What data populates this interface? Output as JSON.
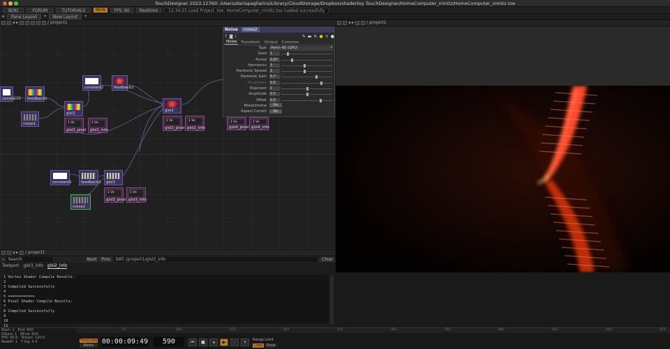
{
  "window": {
    "title": "TouchDesigner 2023.11760: /Users/dariopagliarico/Library/CloudStorage/Dropbox/shadertoy TouchDesigner/HomeComputer_nimitz/HomeComputer_nimitz.toe"
  },
  "menubar": {
    "items": [
      "BOKI",
      "FORUM",
      "TUTORIALS"
    ],
    "badge": "NEW",
    "fps": "FPS: 60",
    "realtime": "Realtime",
    "status": "12:34:25 Load Project .toe: HomeComputer_nimitz.toe loaded successfully"
  },
  "layout": {
    "tabs": [
      "Pane Layout",
      "New Layout"
    ],
    "plus": "+"
  },
  "left_pane": {
    "path": "/ project1"
  },
  "right_pane": {
    "path": "/ project1"
  },
  "nodes": {
    "constant1": "constant1",
    "feedback1": "feedback1",
    "noise1": "noise1",
    "glsl1": "glsl1",
    "glsl1_pixel": "glsl1_pixel",
    "glsl1_info": "glsl1_info",
    "constant2": "constant2",
    "feedback2": "feedback2",
    "glsl2": "glsl2",
    "glsl2_pixel": "glsl2_pixel",
    "glsl2_info": "glsl2_info",
    "glsl4_pixel": "glsl4_pixel",
    "glsl4_info": "glsl4_info",
    "constant3": "constant3",
    "feedback3": "feedback3",
    "glsl3": "glsl3",
    "glsl3_pixel": "glsl3_pixel",
    "glsl3_info": "glsl3_info",
    "noise2": "noise2",
    "dat_snip1": "1 Ve",
    "dat_snip2": "1 Ve",
    "dat_snip3": "1 Ve",
    "dat_snip4": "1 Ve",
    "dat_snip5": "1 Ve",
    "dat_snip6": "1 Ve",
    "dat_snip7": "1 Ve",
    "dat_snip8": "1 Ve"
  },
  "params": {
    "op_type": "Noise",
    "op_name": "noise2",
    "tabs": [
      "Noise",
      "Transform",
      "Output",
      "Common"
    ],
    "type": {
      "label": "Type",
      "value": "Perlin 4D (GPU)"
    },
    "rows": [
      {
        "label": "Seed",
        "value": "1",
        "knob": 0.12
      },
      {
        "label": "Period",
        "value": "0.87",
        "knob": 0.2
      },
      {
        "label": "Harmonics",
        "value": "3",
        "knob": 0.45
      },
      {
        "label": "Harmonic Spread",
        "value": "2",
        "knob": 0.45
      },
      {
        "label": "Harmonic Gain",
        "value": "0.7",
        "knob": 0.7
      },
      {
        "label": "Roughness",
        "value": "0.5",
        "knob": 0.8
      },
      {
        "label": "Exponent",
        "value": "1",
        "knob": 0.52
      },
      {
        "label": "Amplitude",
        "value": "0.5",
        "knob": 0.52
      },
      {
        "label": "Offset",
        "value": "0.5",
        "knob": 0.78
      }
    ],
    "monochrome": {
      "label": "Monochrome",
      "value": "On"
    },
    "aspect": {
      "label": "Aspect Correct",
      "value": "On"
    }
  },
  "textport": {
    "search_label": "Search",
    "next": "Next",
    "prev": "Prev",
    "path": "DAT: /project1/glsl2_info",
    "clear": "Clear",
    "tabs": [
      "Textport",
      "glsl3_info",
      "glsl2_info"
    ],
    "lines": [
      "1 Vertex Shader Compile Results:",
      "2",
      "3 Compiled Successfully",
      "4",
      "5 ============",
      "6 Pixel Shader Compile Results:",
      "7",
      "8 Compiled Successfully",
      "9",
      "10",
      "11",
      "12"
    ]
  },
  "timeline": {
    "info": [
      "Start:",
      "1",
      "End:",
      "600",
      "RStart:",
      "1",
      "REnd:",
      "600",
      "FPS:",
      "60.0",
      "Tempo:",
      "120.0",
      "ResetF:",
      "1",
      "T Sig:",
      "4",
      "4"
    ],
    "timecode_btn": "TimeCode",
    "beats_btn": "Beats",
    "timecode": "00:00:09:49",
    "frame": "590",
    "range_limit": "Range Limit",
    "loop": "Loop",
    "once": "Once",
    "ticks": [
      "51",
      "101",
      "151",
      "201",
      "251",
      "301",
      "351",
      "401",
      "451",
      "501",
      "551"
    ]
  },
  "colors": {
    "accent": "#c57a1e",
    "selected": "#3cc33c",
    "wire": "#7b75b5"
  }
}
